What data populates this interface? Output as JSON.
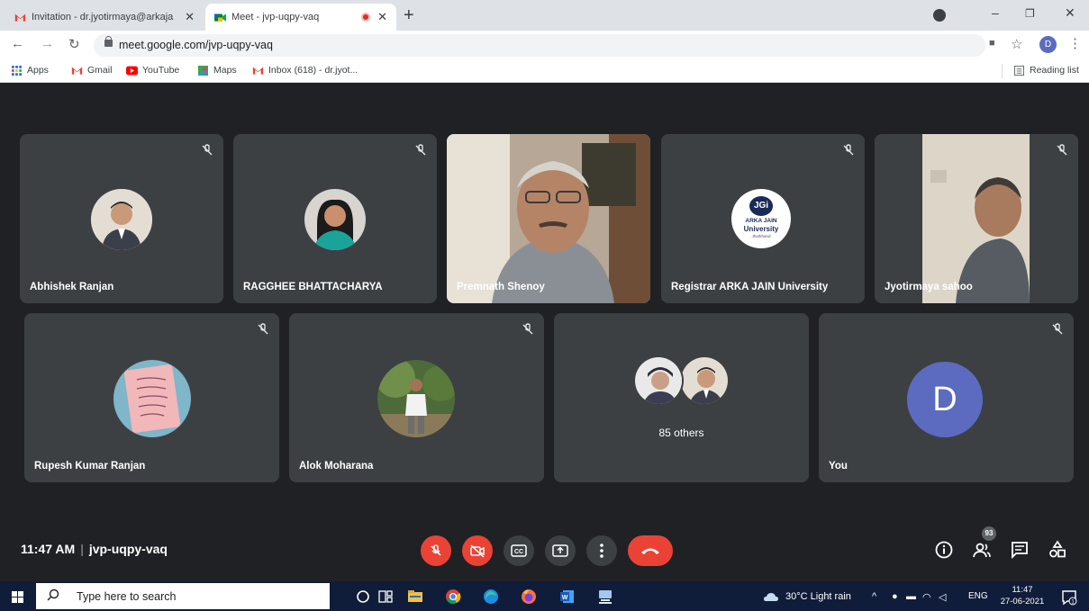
{
  "browser": {
    "tabs": [
      {
        "title": "Invitation - dr.jyotirmaya@arkaja",
        "active": false
      },
      {
        "title": "Meet - jvp-uqpy-vaq",
        "active": true
      }
    ],
    "new_tab": "+",
    "url": "meet.google.com/jvp-uqpy-vaq",
    "profile_initial": "D",
    "bookmarks": [
      {
        "label": "Apps",
        "icon": "apps-icon"
      },
      {
        "label": "Gmail",
        "icon": "gmail-icon"
      },
      {
        "label": "YouTube",
        "icon": "youtube-icon"
      },
      {
        "label": "Maps",
        "icon": "maps-icon"
      },
      {
        "label": "Inbox (618) - dr.jyot...",
        "icon": "gmail-icon"
      }
    ],
    "reading_list": "Reading list"
  },
  "meet": {
    "participants_row1": [
      {
        "name": "Abhishek Ranjan",
        "muted": true,
        "view": "avatar"
      },
      {
        "name": "RAGGHEE BHATTACHARYA",
        "muted": true,
        "view": "avatar"
      },
      {
        "name": "Premnath Shenoy",
        "muted": false,
        "view": "video"
      },
      {
        "name": "Registrar ARKA JAIN University",
        "muted": true,
        "view": "logo"
      },
      {
        "name": "Jyotirmaya sahoo",
        "muted": true,
        "view": "video"
      }
    ],
    "participants_row2": [
      {
        "name": "Rupesh Kumar Ranjan",
        "muted": true,
        "view": "avatar"
      },
      {
        "name": "Alok Moharana",
        "muted": true,
        "view": "avatar"
      },
      {
        "name": "",
        "muted": false,
        "view": "others"
      },
      {
        "name": "You",
        "muted": true,
        "view": "initial"
      }
    ],
    "others_label": "85 others",
    "you_initial": "D",
    "logo_text": {
      "mark": "JGi",
      "line1": "ARKA JAIN",
      "line2": "University",
      "line3": "Jharkhand"
    },
    "time": "11:47 AM",
    "meeting_code": "jvp-uqpy-vaq",
    "people_count": "93",
    "colors": {
      "stage": "#202124",
      "tile": "#3c4043",
      "danger": "#ea4335",
      "you_avatar": "#5c6bc0"
    }
  },
  "taskbar": {
    "search_placeholder": "Type here to search",
    "weather": "30°C  Light rain",
    "language": "ENG",
    "time": "11:47",
    "date": "27-06-2021"
  }
}
